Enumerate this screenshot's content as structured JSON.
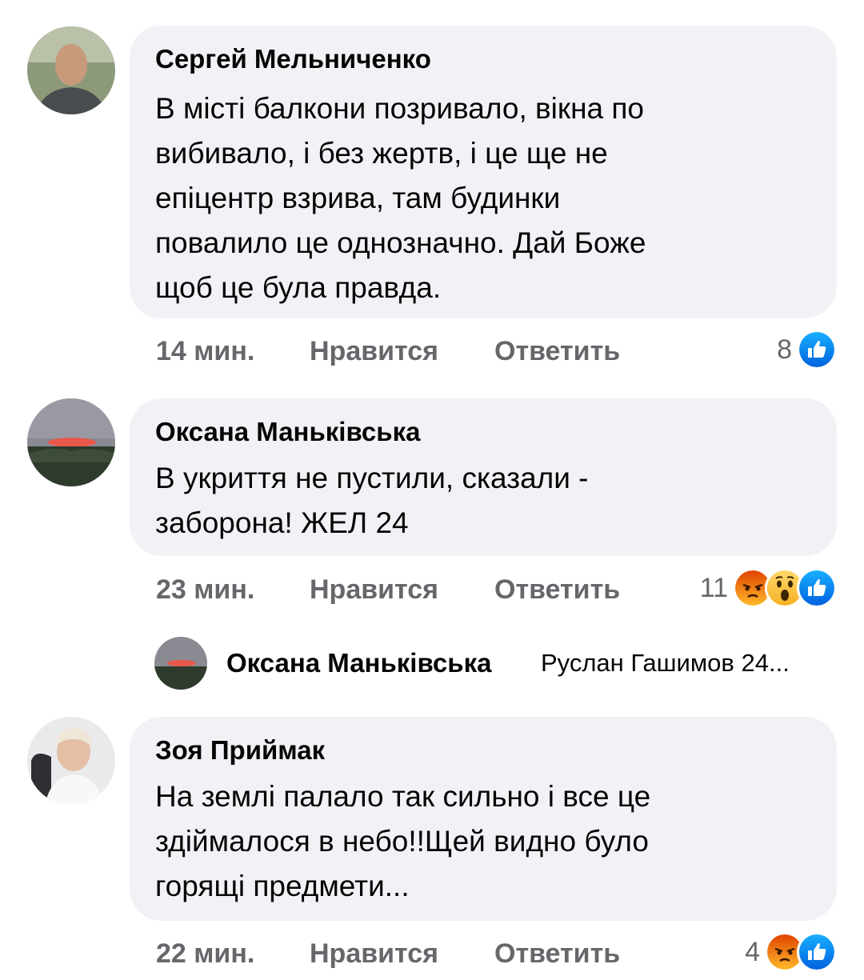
{
  "comments": [
    {
      "author": "Сергей Мельниченко",
      "text": "В місті балкони позривало, вікна по\nвибивало, і без жертв, і це ще не\nепіцентр взрива, там будинки\nповалило це однозначно. Дай Боже\nщоб це була правда.",
      "time": "14 мин.",
      "like_label": "Нравится",
      "reply_label": "Ответить",
      "reaction_count": "8",
      "reactions": [
        "like-icon"
      ]
    },
    {
      "author": "Оксана Маньківська",
      "text": "В укриття не пустили, сказали -\nзаборона! ЖЕЛ 24",
      "time": "23 мин.",
      "like_label": "Нравится",
      "reply_label": "Ответить",
      "reaction_count": "11",
      "reactions": [
        "angry-icon",
        "wow-icon",
        "like-icon"
      ]
    },
    {
      "author": "Зоя Приймак",
      "text": "На землі палало так сильно і все це\nздіймалося в небо!!Щей видно було\nгорящі предмети...",
      "time": "22 мин.",
      "like_label": "Нравится",
      "reply_label": "Ответить",
      "reaction_count": "4",
      "reactions": [
        "angry-icon",
        "like-icon"
      ]
    }
  ],
  "reply_preview": {
    "author": "Оксана Маньківська",
    "text": "Руслан Гашимов 24..."
  },
  "colors": {
    "bubble": "#f0f2f5",
    "meta": "#65676b",
    "like": "#1877f2",
    "angry": "#e9710f"
  }
}
